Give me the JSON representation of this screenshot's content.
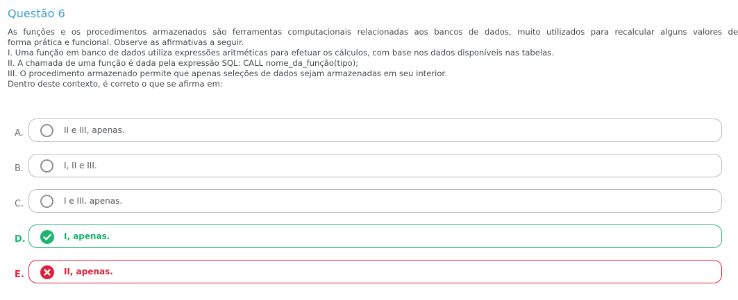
{
  "question": {
    "title": "Questão 6",
    "lines": [
      "As funções e os procedimentos armazenados são ferramentas computacionais relacionadas aos bancos de dados, muito utilizados para recalcular alguns valores de",
      "forma prática e funcional. Observe as afirmativas a seguir.",
      "I. Uma função em banco de dados utiliza expressões aritméticas para efetuar os cálculos, com base nos dados disponíveis nas tabelas.",
      "II. A chamada de uma função é dada pela expressão SQL: CALL nome_da_função(tipo);",
      "III. O procedimento armazenado permite que apenas seleções de dados sejam armazenadas em seu interior.",
      "Dentro deste contexto, é correto o que se afirma em:"
    ]
  },
  "options": [
    {
      "letter": "A.",
      "text": "II e III, apenas.",
      "state": "neutral"
    },
    {
      "letter": "B.",
      "text": "I, II e III.",
      "state": "neutral"
    },
    {
      "letter": "C.",
      "text": "I e III, apenas.",
      "state": "neutral"
    },
    {
      "letter": "D.",
      "text": "I, apenas.",
      "state": "correct"
    },
    {
      "letter": "E.",
      "text": "II, apenas.",
      "state": "wrong"
    }
  ],
  "colors": {
    "title": "#3a9fd3",
    "correct": "#1cb46e",
    "wrong": "#e0203a",
    "neutral_border": "#b9bcbf"
  },
  "icons": {
    "neutral": "radio-circle-icon",
    "correct": "check-circle-icon",
    "wrong": "x-circle-icon"
  }
}
